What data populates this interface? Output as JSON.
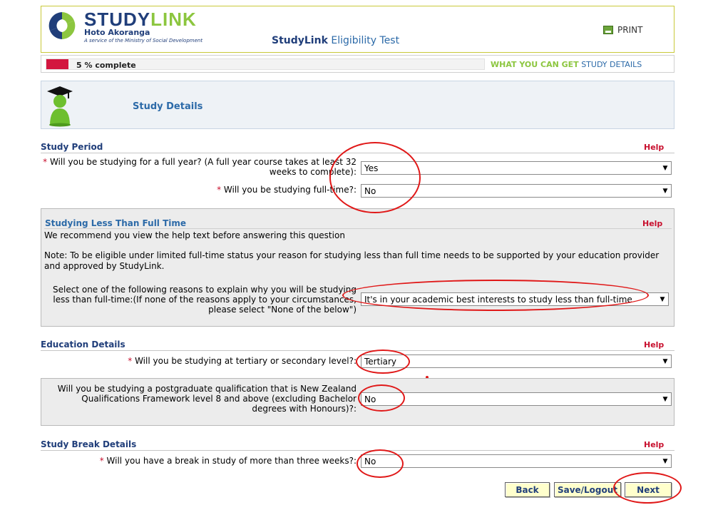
{
  "brand": {
    "name_part1": "STUDY",
    "name_part2": "LINK",
    "subtitle": "Hoto Akoranga",
    "tagline": "A service of the Ministry of Social Development"
  },
  "header": {
    "app_title_bold": "StudyLink",
    "app_title_rest": "Eligibility Test",
    "print_label": "PRINT"
  },
  "progress": {
    "label": "5 % complete",
    "percent": 5,
    "link_what_you_can_get": "WHAT YOU CAN GET",
    "link_study_details": "STUDY DETAILS"
  },
  "study_box": {
    "title": "Study Details"
  },
  "study_period": {
    "title": "Study Period",
    "help": "Help",
    "q1_label": "Will you be studying for a full year? (A full year course takes at least 32 weeks to complete):",
    "q1_value": "Yes",
    "q2_label": "Will you be studying full-time?:",
    "q2_value": "No"
  },
  "less_full_time": {
    "title": "Studying Less Than Full Time",
    "help": "Help",
    "recommend": "We recommend you view the help text before answering this question",
    "note": "Note: To be eligible under limited full-time status your reason for studying less than full time needs to be supported by your education provider and approved by StudyLink.",
    "q_label": "Select one of the following reasons to explain why you will be studying less than full-time:(If none of the reasons apply to your circumstances, please select \"None of the below\")",
    "q_value": "It's in your academic best interests to study less than full-time"
  },
  "education": {
    "title": "Education Details",
    "help": "Help",
    "q1_label": "Will you be studying at tertiary or secondary level?:",
    "q1_value": "Tertiary",
    "q2_label": "Will you be studying a postgraduate qualification that is New Zealand Qualifications Framework level 8 and above (excluding Bachelor degrees with Honours)?:",
    "q2_value": "No"
  },
  "study_break": {
    "title": "Study Break Details",
    "help": "Help",
    "q_label": "Will you have a break in study of more than three weeks?:",
    "q_value": "No"
  },
  "buttons": {
    "back": "Back",
    "save": "Save/Logout",
    "next": "Next"
  },
  "required_marker": "*",
  "colors": {
    "accent_red": "#d3163f",
    "brand_navy": "#203e7a",
    "brand_green": "#8cc63f",
    "annotation_red": "#e01818"
  }
}
